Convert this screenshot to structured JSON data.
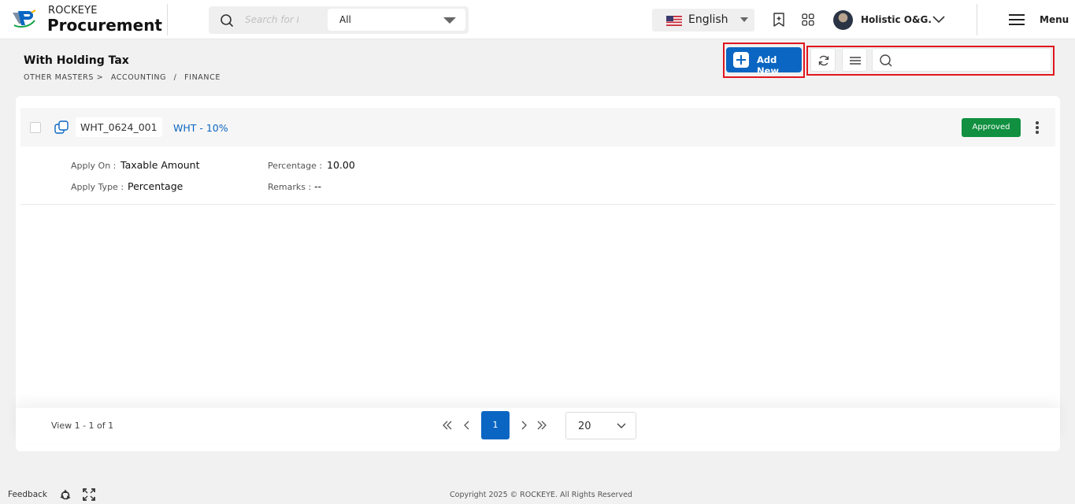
{
  "colors": {
    "accent": "#0a66c2",
    "approved": "#109040",
    "highlight": "#e0161e"
  },
  "header": {
    "brand_top": "ROCKEYE",
    "brand_main": "Procurement",
    "search_placeholder": "Search for P",
    "category_value": "All",
    "language": "English",
    "user_name": "Holistic O&G.",
    "menu_label": "Menu",
    "icons": [
      "search-icon",
      "chevron-down-icon",
      "us-flag-icon",
      "bookmark-add-icon",
      "apps-grid-icon",
      "user-avatar",
      "hamburger-icon"
    ]
  },
  "page": {
    "title": "With Holding Tax",
    "breadcrumb": [
      "OTHER MASTERS >",
      "ACCOUNTING",
      "/",
      "FINANCE"
    ]
  },
  "toolbar": {
    "add_label": "Add New",
    "search_placeholder": "",
    "icons": [
      "plus-icon",
      "refresh-icon",
      "list-icon",
      "search-icon"
    ]
  },
  "record": {
    "code": "WHT_0624_001",
    "name": "WHT - 10%",
    "status": "Approved",
    "fields": {
      "apply_on_label": "Apply On :",
      "apply_on_value": "Taxable Amount",
      "apply_type_label": "Apply Type :",
      "apply_type_value": "Percentage",
      "percentage_label": "Percentage :",
      "percentage_value": "10.00",
      "remarks_label": "Remarks :",
      "remarks_value": "--"
    }
  },
  "pagination": {
    "view_text": "View 1 - 1 of 1",
    "current_page": "1",
    "page_size": "20"
  },
  "footer": {
    "feedback": "Feedback",
    "copyright": "Copyright 2025 © ROCKEYE. All Rights Reserved"
  }
}
